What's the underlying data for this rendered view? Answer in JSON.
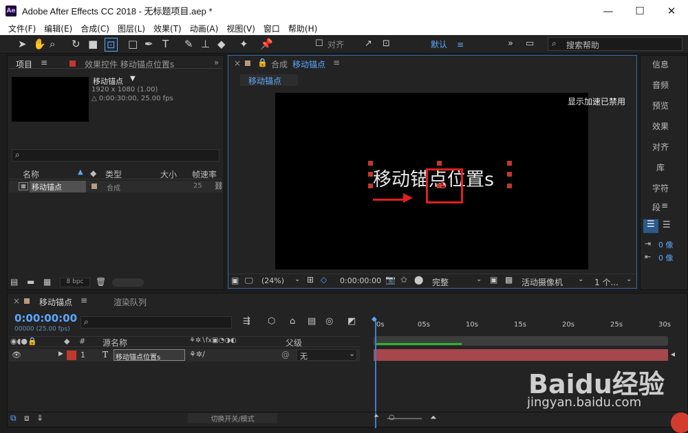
{
  "window": {
    "title": "Adobe After Effects CC 2018 - 无标题项目.aep *",
    "logo": "Ae",
    "minimize": "—",
    "maximize": "☐",
    "close": "✕"
  },
  "menu": [
    "文件(F)",
    "编辑(E)",
    "合成(C)",
    "图层(L)",
    "效果(T)",
    "动画(A)",
    "视图(V)",
    "窗口",
    "帮助(H)"
  ],
  "toolbar": {
    "align_label": "对齐",
    "workspace": "默认",
    "search_placeholder": "搜索帮助"
  },
  "project": {
    "tab": "项目",
    "effects_tab": "效果控件 移动锚点位置s",
    "item_name": "移动锚点",
    "item_size": "1920 x 1080 (1.00)",
    "item_duration": "△ 0:00:30:00, 25.00 fps",
    "search_placeholder": "",
    "columns": {
      "name": "名称",
      "type": "类型",
      "size": "大小",
      "fps": "帧速率"
    },
    "rows": [
      {
        "name": "移动锚点",
        "type": "合成",
        "fps": "25"
      }
    ],
    "bpc": "8 bpc"
  },
  "comp": {
    "close": "×",
    "tab_prefix": "合成",
    "tab_name": "移动锚点",
    "breadcrumb": "移动锚点",
    "accel": "显示加速已禁用",
    "layer_text": "移动锚点位置s",
    "zoom": "(24%)",
    "timecode": "0:00:00:00",
    "quality": "完整",
    "camera": "活动摄像机",
    "views": "1 个..."
  },
  "right_panel": {
    "items": [
      "信息",
      "音频",
      "预览",
      "效果",
      "对齐",
      "库",
      "字符",
      "段"
    ],
    "para_val1": "0 像",
    "para_val2": "0 像"
  },
  "timeline": {
    "tab": "移动锚点",
    "render_tab": "渲染队列",
    "timecode": "0:00:00:00",
    "frames": "00000 (25.00 fps)",
    "col_source": "源名称",
    "col_parent": "父级",
    "col_num": "#",
    "layers": [
      {
        "num": "1",
        "type": "T",
        "name": "移动锚点位置s",
        "parent": "无"
      }
    ],
    "ruler": [
      "0s",
      "05s",
      "10s",
      "15s",
      "20s",
      "25s",
      "30s"
    ],
    "footer": "切换开关/模式"
  },
  "watermark": {
    "brand": "Baidu经验",
    "url": "jingyan.baidu.com"
  },
  "colors": {
    "accent": "#5aa8ff",
    "layer_bar": "#a5474c",
    "label_red": "#c0392b"
  }
}
